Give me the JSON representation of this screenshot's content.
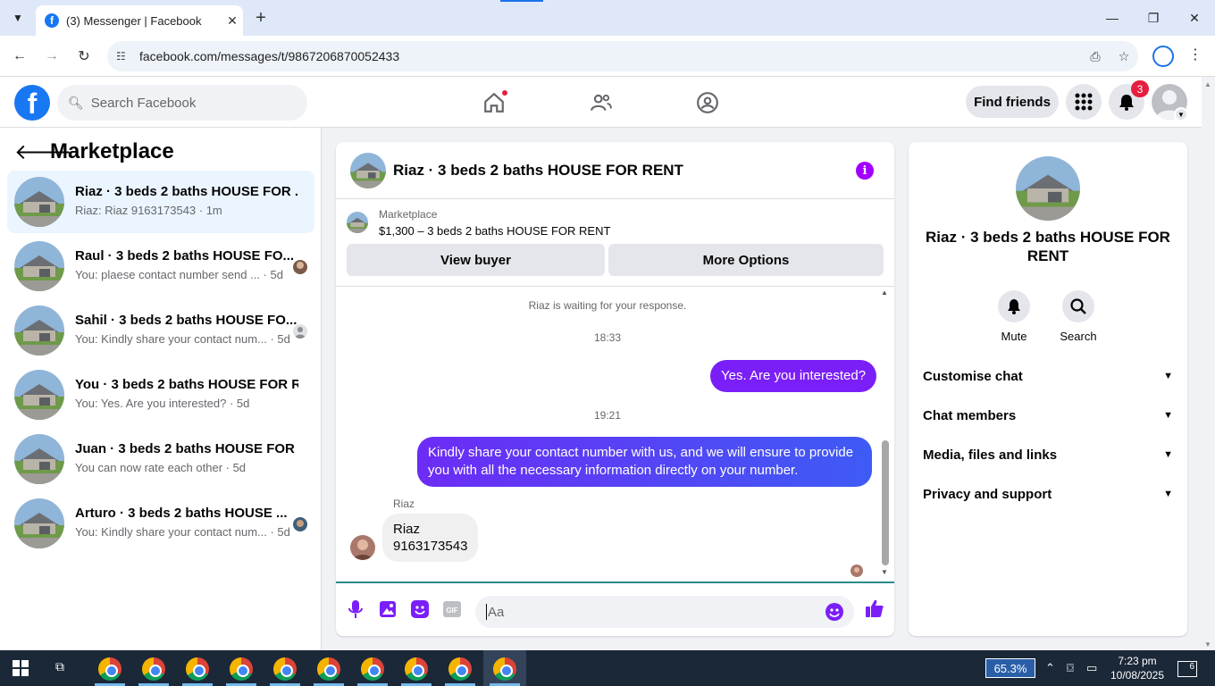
{
  "browser": {
    "tab_title": "(3) Messenger | Facebook",
    "url": "facebook.com/messages/t/9867206870052433",
    "new_tab": "+",
    "tab_close": "✕"
  },
  "fb_header": {
    "logo_letter": "f",
    "search_placeholder": "Search Facebook",
    "find_friends": "Find friends",
    "notification_count": "3"
  },
  "sidebar": {
    "title": "Marketplace",
    "conversations": [
      {
        "name": "Riaz · 3 beds 2 baths HOUSE FOR ...",
        "preview": "Riaz: Riaz 9163173543 · 1m",
        "active": true
      },
      {
        "name": "Raul · 3 beds 2 baths HOUSE FO...",
        "preview": "You: plaese contact number send ... · 5d"
      },
      {
        "name": "Sahil · 3 beds 2 baths HOUSE FO...",
        "preview": "You: Kindly share your contact num... · 5d"
      },
      {
        "name": "You · 3 beds 2 baths HOUSE FOR R...",
        "preview": "You: Yes. Are you interested? · 5d"
      },
      {
        "name": "Juan · 3 beds 2 baths HOUSE FOR ...",
        "preview": "You can now rate each other · 5d"
      },
      {
        "name": "Arturo · 3 beds 2 baths HOUSE ...",
        "preview": "You: Kindly share your contact num... · 5d"
      }
    ]
  },
  "chat": {
    "title": "Riaz · 3 beds 2 baths HOUSE FOR RENT",
    "info_glyph": "i",
    "marketplace_label": "Marketplace",
    "listing": "$1,300 – 3 beds 2 baths HOUSE FOR RENT",
    "view_buyer": "View buyer",
    "more_options": "More Options",
    "waiting_note": "Riaz is waiting for your response.",
    "time1": "18:33",
    "msg1": "Yes. Are you interested?",
    "time2": "19:21",
    "msg2_line1": "Kindly share your contact number with us, and we will ensure to provide",
    "msg2_line2": "you with all the necessary information directly on your number.",
    "sender": "Riaz",
    "incoming_line1": "Riaz",
    "incoming_line2": "9163173543",
    "composer_placeholder": "Aa"
  },
  "right_panel": {
    "title": "Riaz · 3 beds 2 baths HOUSE FOR RENT",
    "mute": "Mute",
    "search": "Search",
    "sections": [
      "Customise chat",
      "Chat members",
      "Media, files and links",
      "Privacy and support"
    ]
  },
  "taskbar": {
    "battery": "65.3%",
    "time": "7:23 pm",
    "date": "10/08/2025",
    "notifications": "6"
  },
  "colors": {
    "fb_blue": "#1877f2",
    "messenger_purple": "#7b1ff8",
    "notification_red": "#e41e3f"
  }
}
